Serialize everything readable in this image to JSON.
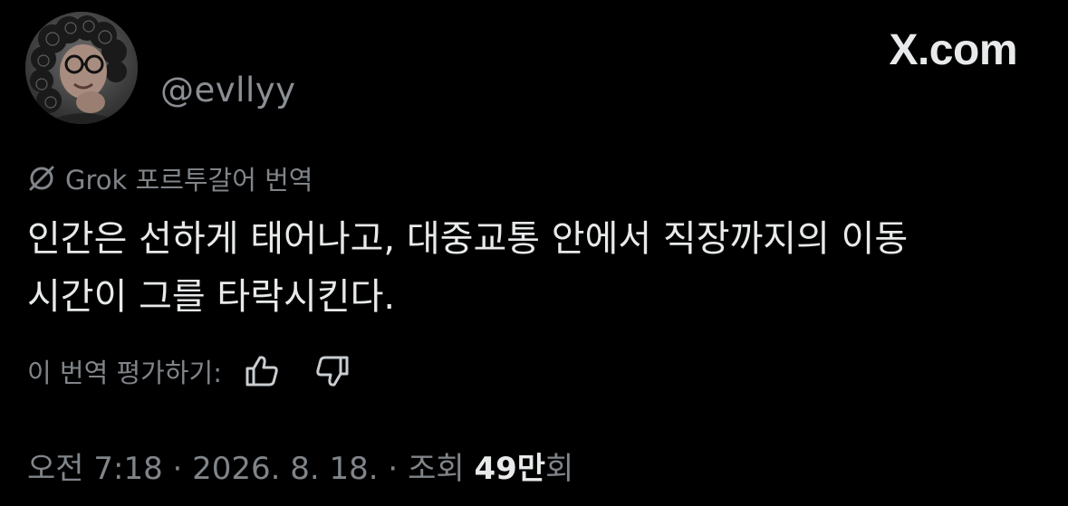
{
  "author": {
    "handle": "@evllyy",
    "avatar_icon": "profile-photo"
  },
  "brand": {
    "label": "X.com"
  },
  "translation": {
    "icon": "grok-icon",
    "label": "Grok 포르투갈어 번역"
  },
  "post": {
    "line1": "인간은 선하게 태어나고, 대중교통 안에서 직장까지의 이동",
    "line2": "시간이 그를 타락시킨다."
  },
  "rating": {
    "label": "이 번역 평가하기:",
    "up_icon": "thumbs-up-icon",
    "down_icon": "thumbs-down-icon"
  },
  "meta": {
    "time": "오전 7:18",
    "sep1": " · ",
    "date": "2026. 8. 18.",
    "sep2": " · ",
    "views_prefix": "조회 ",
    "views_count": "49만",
    "views_suffix": "회"
  },
  "colors": {
    "background": "#000000",
    "primary_text": "#e7e9ea",
    "secondary_text": "#80858a"
  }
}
